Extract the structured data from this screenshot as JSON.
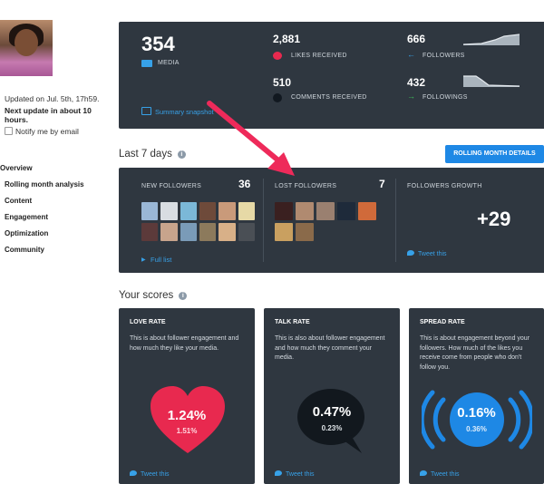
{
  "sidebar": {
    "updated": "Updated on Jul. 5th, 17h59.",
    "next_update": "Next update in about 10 hours.",
    "notify": "Notify me by email",
    "nav": [
      "Overview",
      "Rolling month analysis",
      "Content",
      "Engagement",
      "Optimization",
      "Community"
    ]
  },
  "stats": {
    "media_value": "354",
    "media_label": "MEDIA",
    "likes_value": "2,881",
    "likes_label": "LIKES RECEIVED",
    "comments_value": "510",
    "comments_label": "COMMENTS RECEIVED",
    "followers_value": "666",
    "followers_label": "FOLLOWERS",
    "followings_value": "432",
    "followings_label": "FOLLOWINGS",
    "summary_link": "Summary snapshot"
  },
  "last7": {
    "title": "Last 7 days",
    "button": "ROLLING MONTH DETAILS",
    "new_followers_label": "NEW FOLLOWERS",
    "new_followers_count": "36",
    "lost_followers_label": "LOST FOLLOWERS",
    "lost_followers_count": "7",
    "growth_label": "FOLLOWERS GROWTH",
    "growth_value": "+29",
    "full_list": "Full list",
    "tweet": "Tweet this"
  },
  "scores": {
    "title": "Your scores",
    "love": {
      "title": "LOVE RATE",
      "desc": "This is about follower engagement and how much they like your media.",
      "value": "1.24%",
      "sub": "1.51%",
      "tweet": "Tweet this"
    },
    "talk": {
      "title": "TALK RATE",
      "desc": "This is also about follower engagement and how much they comment your media.",
      "value": "0.47%",
      "sub": "0.23%",
      "tweet": "Tweet this"
    },
    "spread": {
      "title": "SPREAD RATE",
      "desc": "This is about engagement beyond your followers. How much of the likes you receive come from people who don't follow you.",
      "value": "0.16%",
      "sub": "0.36%",
      "tweet": "Tweet this"
    }
  },
  "colors": {
    "panel": "#2f3740",
    "accent_blue": "#1e88e5",
    "love_red": "#e8294f",
    "arrow_pink": "#ee2a5a"
  }
}
